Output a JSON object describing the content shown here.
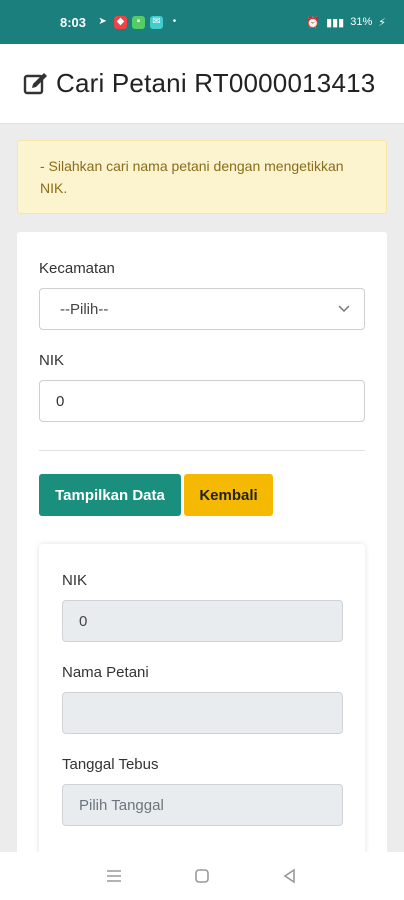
{
  "status_bar": {
    "time": "8:03",
    "battery": "31%",
    "signal": "Vo)) LTE1"
  },
  "header": {
    "title": "Cari Petani RT0000013413"
  },
  "alert": {
    "message": "- Silahkan cari nama petani dengan mengetikkan NIK."
  },
  "form": {
    "kecamatan_label": "Kecamatan",
    "kecamatan_value": "--Pilih--",
    "nik_label": "NIK",
    "nik_value": "0"
  },
  "buttons": {
    "show_label": "Tampilkan Data",
    "back_label": "Kembali"
  },
  "result": {
    "nik_label": "NIK",
    "nik_value": "0",
    "nama_label": "Nama Petani",
    "nama_value": "",
    "tanggal_label": "Tanggal Tebus",
    "tanggal_placeholder": "Pilih Tanggal"
  },
  "colors": {
    "status_bar": "#1a7f7d",
    "primary_button": "#1a8f7e",
    "warning_button": "#f6b902",
    "alert_bg": "#fcf3cf",
    "alert_text": "#8a6d1a"
  },
  "icons": {
    "header": "edit-icon",
    "select": "chevron-down-icon",
    "nav": [
      "menu-icon",
      "home-icon",
      "back-icon"
    ]
  }
}
